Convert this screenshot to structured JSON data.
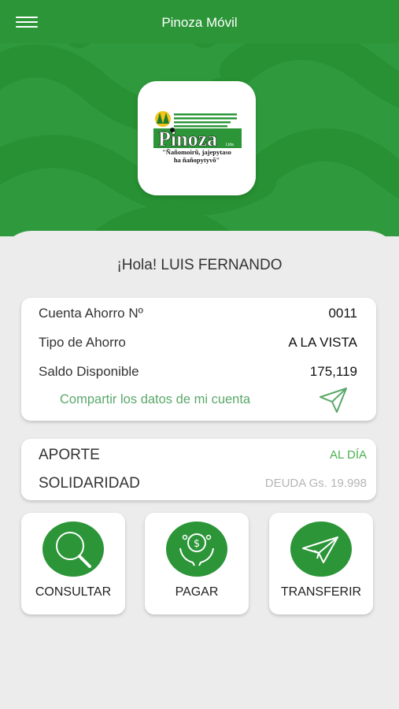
{
  "topbar": {
    "title": "Pinoza Móvil"
  },
  "logo": {
    "name": "Pinoza",
    "suffix": "Ltda",
    "tagline_line1": "\"Ñañomoirũ, jajepytaso",
    "tagline_line2": "ha ñañopytyvõ\""
  },
  "greeting": "¡Hola! LUIS FERNANDO",
  "account": {
    "rows": [
      {
        "label": "Cuenta Ahorro Nº",
        "value": "0011"
      },
      {
        "label": "Tipo de Ahorro",
        "value": "A LA VISTA"
      },
      {
        "label": "Saldo Disponible",
        "value": "175,119"
      }
    ],
    "share_label": "Compartir los datos de mi cuenta"
  },
  "contributions": [
    {
      "label": "APORTE",
      "status": "AL DÍA",
      "status_color": "#4caf50"
    },
    {
      "label": "SOLIDARIDAD",
      "status": "DEUDA Gs. 19.998",
      "status_color": "#b5b5b5"
    }
  ],
  "actions": [
    {
      "label": "CONSULTAR",
      "icon": "magnifier-icon"
    },
    {
      "label": "PAGAR",
      "icon": "money-hands-icon"
    },
    {
      "label": "TRANSFERIR",
      "icon": "paper-plane-icon"
    }
  ],
  "colors": {
    "brand_green": "#2b9538",
    "accent_green": "#5aa86a"
  }
}
